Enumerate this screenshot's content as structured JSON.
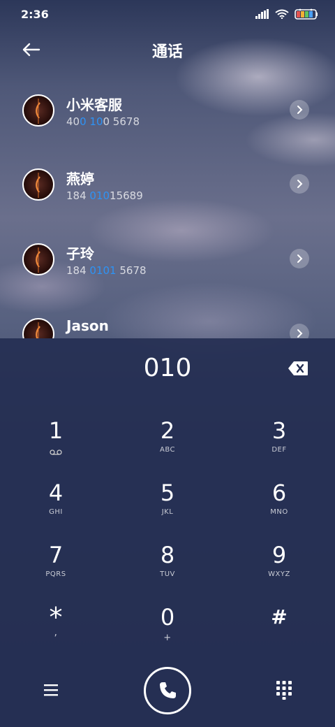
{
  "status_bar": {
    "time": "2:36"
  },
  "header": {
    "title": "通话"
  },
  "contacts": [
    {
      "name": "小米客服",
      "number_parts": [
        "40",
        "0 10",
        "0 5678"
      ],
      "highlight_index": 1
    },
    {
      "name": "燕婷",
      "number_parts": [
        "184 ",
        "010",
        "15689"
      ],
      "highlight_index": 1
    },
    {
      "name": "子玲",
      "number_parts": [
        "184 ",
        "0101",
        " 5678"
      ],
      "highlight_index": 1
    },
    {
      "name": "Jason",
      "number_parts": [
        "",
        "",
        ""
      ],
      "highlight_index": 1
    }
  ],
  "dialer": {
    "input": "010"
  },
  "keypad": [
    {
      "digit": "1",
      "sub": ""
    },
    {
      "digit": "2",
      "sub": "ABC"
    },
    {
      "digit": "3",
      "sub": "DEF"
    },
    {
      "digit": "4",
      "sub": "GHI"
    },
    {
      "digit": "5",
      "sub": "JKL"
    },
    {
      "digit": "6",
      "sub": "MNO"
    },
    {
      "digit": "7",
      "sub": "PQRS"
    },
    {
      "digit": "8",
      "sub": "TUV"
    },
    {
      "digit": "9",
      "sub": "WXYZ"
    },
    {
      "digit": "*",
      "sub": ","
    },
    {
      "digit": "0",
      "sub": "+"
    },
    {
      "digit": "#",
      "sub": ""
    }
  ],
  "colors": {
    "highlight": "#2e93f5",
    "panel": "#252f52"
  }
}
